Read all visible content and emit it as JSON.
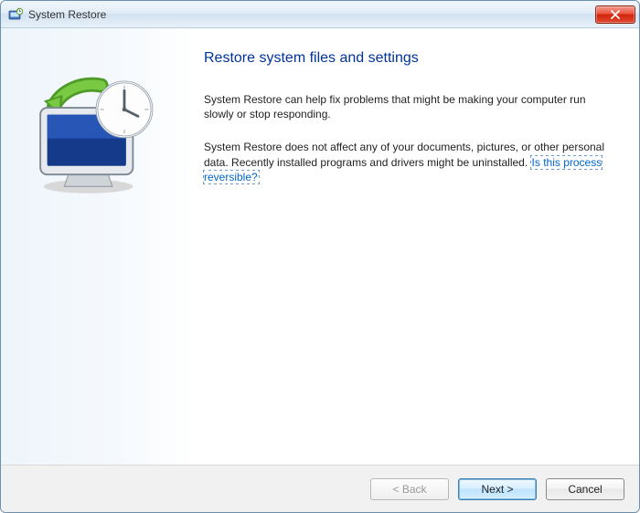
{
  "window": {
    "title": "System Restore"
  },
  "content": {
    "heading": "Restore system files and settings",
    "paragraph1": "System Restore can help fix problems that might be making your computer run slowly or stop responding.",
    "paragraph2_pre": "System Restore does not affect any of your documents, pictures, or other personal data. Recently installed programs and drivers might be uninstalled. ",
    "help_link_text": "Is this process reversible?"
  },
  "buttons": {
    "back": "< Back",
    "next": "Next >",
    "cancel": "Cancel"
  }
}
